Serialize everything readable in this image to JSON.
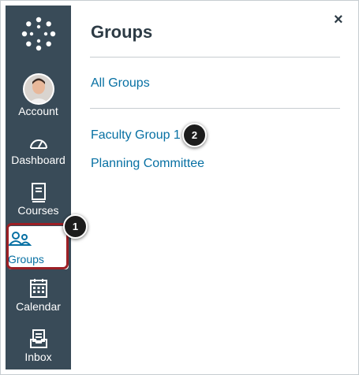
{
  "tray": {
    "title": "Groups",
    "close_icon": "×",
    "all_groups": "All Groups",
    "groups": [
      "Faculty Group 1",
      "Planning Committee"
    ]
  },
  "nav": {
    "account": "Account",
    "dashboard": "Dashboard",
    "courses": "Courses",
    "groups": "Groups",
    "calendar": "Calendar",
    "inbox": "Inbox"
  },
  "callouts": {
    "one": "1",
    "two": "2"
  },
  "colors": {
    "sidebar": "#394b58",
    "link": "#0770a3",
    "highlight": "#9c1f25"
  }
}
